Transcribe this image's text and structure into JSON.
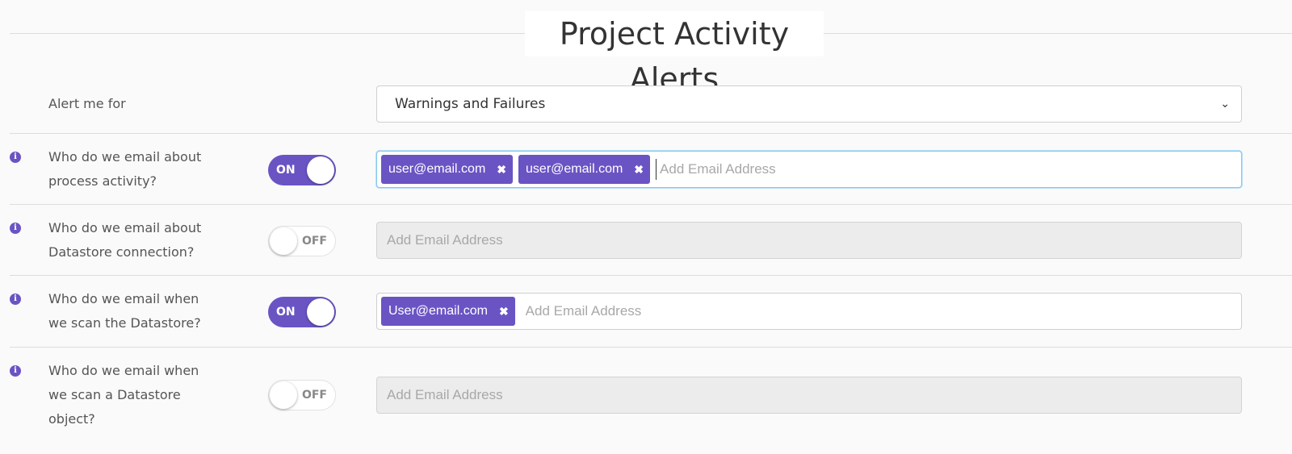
{
  "page": {
    "title": "Project Activity Alerts"
  },
  "alert_level": {
    "label": "Alert me for",
    "selected": "Warnings and Failures"
  },
  "rows": [
    {
      "label_line1": "Who do we email about",
      "label_line2": "process activity?",
      "label_line3": "",
      "toggle": "ON",
      "emails": [
        "user@email.com",
        "user@email.com"
      ],
      "placeholder": "Add Email Address"
    },
    {
      "label_line1": "Who do we email about",
      "label_line2": "Datastore connection?",
      "label_line3": "",
      "toggle": "OFF",
      "emails": [],
      "placeholder": "Add Email Address"
    },
    {
      "label_line1": "Who do we email when",
      "label_line2": "we scan the Datastore?",
      "label_line3": "",
      "toggle": "ON",
      "emails": [
        "User@email.com"
      ],
      "placeholder": "Add Email Address"
    },
    {
      "label_line1": "Who do we email when",
      "label_line2": "we scan a Datastore",
      "label_line3": "object?",
      "toggle": "OFF",
      "emails": [],
      "placeholder": "Add Email Address"
    }
  ],
  "icons": {
    "info": "info-icon",
    "remove": "close-icon",
    "dropdown": "chevron-down-icon"
  },
  "colors": {
    "accent": "#6a54c4",
    "focus_border": "#86c8ee",
    "disabled_bg": "#ececec"
  }
}
